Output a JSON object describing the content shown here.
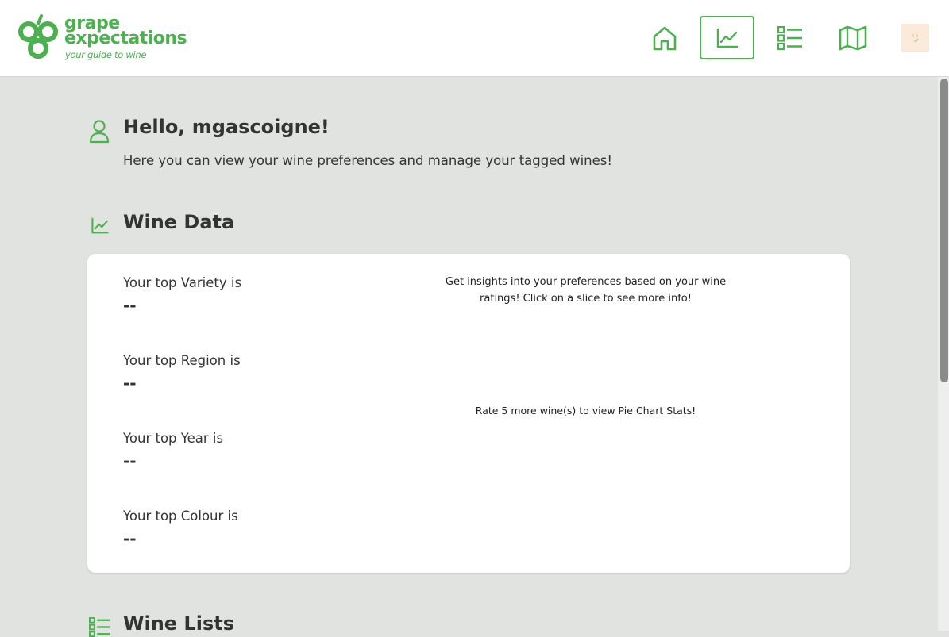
{
  "brand": {
    "line1": "grape",
    "line2": "expectations",
    "tagline": "your guide to wine",
    "color": "#4caf50"
  },
  "nav": {
    "items": [
      {
        "name": "home",
        "icon": "home-icon",
        "active": false
      },
      {
        "name": "stats",
        "icon": "chart-line-icon",
        "active": true
      },
      {
        "name": "lists",
        "icon": "list-icon",
        "active": false
      },
      {
        "name": "map",
        "icon": "map-icon",
        "active": false
      }
    ]
  },
  "greeting": {
    "title": "Hello, mgascoigne!",
    "subtitle": "Here you can view your wine preferences and manage your tagged wines!"
  },
  "wine_data": {
    "title": "Wine Data",
    "stats": [
      {
        "label": "Your top Variety is",
        "value": "--"
      },
      {
        "label": "Your top Region is",
        "value": "--"
      },
      {
        "label": "Your top Year is",
        "value": "--"
      },
      {
        "label": "Your top Colour is",
        "value": "--"
      }
    ],
    "insight": "Get insights into your preferences based on your wine ratings! Click on a slice to see more info!",
    "rate_message": "Rate 5 more wine(s) to view Pie Chart Stats!"
  },
  "wine_lists": {
    "title": "Wine Lists"
  },
  "colors": {
    "accent": "#4caf50",
    "background": "#e1e3e0",
    "card": "#ffffff"
  }
}
